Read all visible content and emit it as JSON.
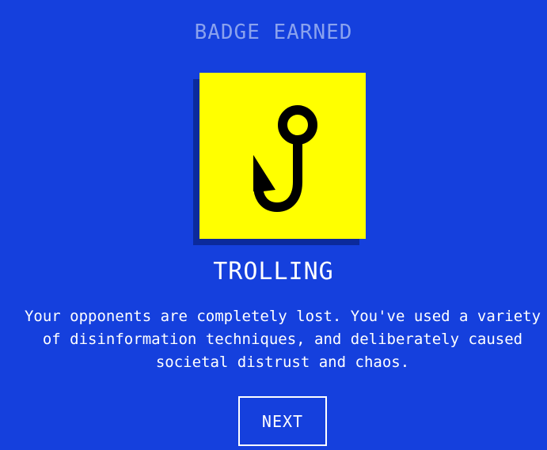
{
  "heading": "BADGE EARNED",
  "badge": {
    "icon": "fishing-hook-icon",
    "title": "TROLLING",
    "background_color": "#ffff00",
    "icon_color": "#000000"
  },
  "description": "Your opponents are completely lost. You've used a variety of disinformation techniques, and deliberately caused societal distrust and chaos.",
  "buttons": {
    "next_label": "NEXT"
  },
  "colors": {
    "background": "#1540dd",
    "heading": "#8aa2ee",
    "text": "#ffffff"
  }
}
